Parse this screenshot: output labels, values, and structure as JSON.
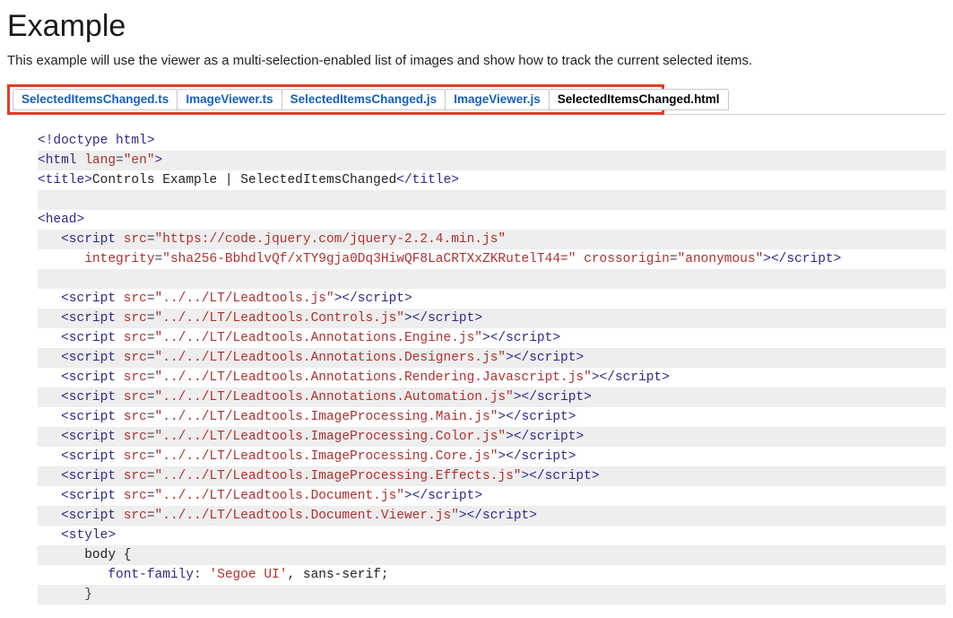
{
  "heading": "Example",
  "description": "This example will use the viewer as a multi-selection-enabled list of images and show how to track the current selected items.",
  "tabs": [
    {
      "label": "SelectedItemsChanged.ts",
      "active": false
    },
    {
      "label": "ImageViewer.ts",
      "active": false
    },
    {
      "label": "SelectedItemsChanged.js",
      "active": false
    },
    {
      "label": "ImageViewer.js",
      "active": false
    },
    {
      "label": "SelectedItemsChanged.html",
      "active": true
    }
  ],
  "code": [
    {
      "indent": 0,
      "stripe": false,
      "tokens": [
        {
          "t": "<!doctype html>",
          "c": "tag"
        }
      ]
    },
    {
      "indent": 0,
      "stripe": true,
      "tokens": [
        {
          "t": "<html ",
          "c": "tag"
        },
        {
          "t": "lang",
          "c": "attr"
        },
        {
          "t": "=",
          "c": "pun"
        },
        {
          "t": "\"en\"",
          "c": "str"
        },
        {
          "t": ">",
          "c": "tag"
        }
      ]
    },
    {
      "indent": 0,
      "stripe": false,
      "tokens": [
        {
          "t": "<title>",
          "c": "tag"
        },
        {
          "t": "Controls Example | SelectedItemsChanged",
          "c": "plain"
        },
        {
          "t": "</title>",
          "c": "tag"
        }
      ]
    },
    {
      "indent": 0,
      "stripe": true,
      "tokens": []
    },
    {
      "indent": 0,
      "stripe": false,
      "tokens": [
        {
          "t": "<head>",
          "c": "tag"
        }
      ]
    },
    {
      "indent": 1,
      "stripe": true,
      "tokens": [
        {
          "t": "<script ",
          "c": "tag"
        },
        {
          "t": "src",
          "c": "attr"
        },
        {
          "t": "=",
          "c": "pun"
        },
        {
          "t": "\"https://code.jquery.com/jquery-2.2.4.min.js\"",
          "c": "str"
        }
      ]
    },
    {
      "indent": 2,
      "stripe": false,
      "tokens": [
        {
          "t": "integrity",
          "c": "attr"
        },
        {
          "t": "=",
          "c": "pun"
        },
        {
          "t": "\"sha256-BbhdlvQf/xTY9gja0Dq3HiwQF8LaCRTXxZKRutelT44=\"",
          "c": "str"
        },
        {
          "t": " ",
          "c": "plain"
        },
        {
          "t": "crossorigin",
          "c": "attr"
        },
        {
          "t": "=",
          "c": "pun"
        },
        {
          "t": "\"anonymous\"",
          "c": "str"
        },
        {
          "t": "></",
          "c": "tag"
        },
        {
          "t": "script",
          "c": "tag"
        },
        {
          "t": ">",
          "c": "tag"
        }
      ]
    },
    {
      "indent": 0,
      "stripe": true,
      "tokens": []
    },
    {
      "indent": 1,
      "stripe": false,
      "tokens": [
        {
          "t": "<script ",
          "c": "tag"
        },
        {
          "t": "src",
          "c": "attr"
        },
        {
          "t": "=",
          "c": "pun"
        },
        {
          "t": "\"../../LT/Leadtools.js\"",
          "c": "str"
        },
        {
          "t": "></",
          "c": "tag"
        },
        {
          "t": "script",
          "c": "tag"
        },
        {
          "t": ">",
          "c": "tag"
        }
      ]
    },
    {
      "indent": 1,
      "stripe": true,
      "tokens": [
        {
          "t": "<script ",
          "c": "tag"
        },
        {
          "t": "src",
          "c": "attr"
        },
        {
          "t": "=",
          "c": "pun"
        },
        {
          "t": "\"../../LT/Leadtools.Controls.js\"",
          "c": "str"
        },
        {
          "t": "></",
          "c": "tag"
        },
        {
          "t": "script",
          "c": "tag"
        },
        {
          "t": ">",
          "c": "tag"
        }
      ]
    },
    {
      "indent": 1,
      "stripe": false,
      "tokens": [
        {
          "t": "<script ",
          "c": "tag"
        },
        {
          "t": "src",
          "c": "attr"
        },
        {
          "t": "=",
          "c": "pun"
        },
        {
          "t": "\"../../LT/Leadtools.Annotations.Engine.js\"",
          "c": "str"
        },
        {
          "t": "></",
          "c": "tag"
        },
        {
          "t": "script",
          "c": "tag"
        },
        {
          "t": ">",
          "c": "tag"
        }
      ]
    },
    {
      "indent": 1,
      "stripe": true,
      "tokens": [
        {
          "t": "<script ",
          "c": "tag"
        },
        {
          "t": "src",
          "c": "attr"
        },
        {
          "t": "=",
          "c": "pun"
        },
        {
          "t": "\"../../LT/Leadtools.Annotations.Designers.js\"",
          "c": "str"
        },
        {
          "t": "></",
          "c": "tag"
        },
        {
          "t": "script",
          "c": "tag"
        },
        {
          "t": ">",
          "c": "tag"
        }
      ]
    },
    {
      "indent": 1,
      "stripe": false,
      "tokens": [
        {
          "t": "<script ",
          "c": "tag"
        },
        {
          "t": "src",
          "c": "attr"
        },
        {
          "t": "=",
          "c": "pun"
        },
        {
          "t": "\"../../LT/Leadtools.Annotations.Rendering.Javascript.js\"",
          "c": "str"
        },
        {
          "t": "></",
          "c": "tag"
        },
        {
          "t": "script",
          "c": "tag"
        },
        {
          "t": ">",
          "c": "tag"
        }
      ]
    },
    {
      "indent": 1,
      "stripe": true,
      "tokens": [
        {
          "t": "<script ",
          "c": "tag"
        },
        {
          "t": "src",
          "c": "attr"
        },
        {
          "t": "=",
          "c": "pun"
        },
        {
          "t": "\"../../LT/Leadtools.Annotations.Automation.js\"",
          "c": "str"
        },
        {
          "t": "></",
          "c": "tag"
        },
        {
          "t": "script",
          "c": "tag"
        },
        {
          "t": ">",
          "c": "tag"
        }
      ]
    },
    {
      "indent": 1,
      "stripe": false,
      "tokens": [
        {
          "t": "<script ",
          "c": "tag"
        },
        {
          "t": "src",
          "c": "attr"
        },
        {
          "t": "=",
          "c": "pun"
        },
        {
          "t": "\"../../LT/Leadtools.ImageProcessing.Main.js\"",
          "c": "str"
        },
        {
          "t": "></",
          "c": "tag"
        },
        {
          "t": "script",
          "c": "tag"
        },
        {
          "t": ">",
          "c": "tag"
        }
      ]
    },
    {
      "indent": 1,
      "stripe": true,
      "tokens": [
        {
          "t": "<script ",
          "c": "tag"
        },
        {
          "t": "src",
          "c": "attr"
        },
        {
          "t": "=",
          "c": "pun"
        },
        {
          "t": "\"../../LT/Leadtools.ImageProcessing.Color.js\"",
          "c": "str"
        },
        {
          "t": "></",
          "c": "tag"
        },
        {
          "t": "script",
          "c": "tag"
        },
        {
          "t": ">",
          "c": "tag"
        }
      ]
    },
    {
      "indent": 1,
      "stripe": false,
      "tokens": [
        {
          "t": "<script ",
          "c": "tag"
        },
        {
          "t": "src",
          "c": "attr"
        },
        {
          "t": "=",
          "c": "pun"
        },
        {
          "t": "\"../../LT/Leadtools.ImageProcessing.Core.js\"",
          "c": "str"
        },
        {
          "t": "></",
          "c": "tag"
        },
        {
          "t": "script",
          "c": "tag"
        },
        {
          "t": ">",
          "c": "tag"
        }
      ]
    },
    {
      "indent": 1,
      "stripe": true,
      "tokens": [
        {
          "t": "<script ",
          "c": "tag"
        },
        {
          "t": "src",
          "c": "attr"
        },
        {
          "t": "=",
          "c": "pun"
        },
        {
          "t": "\"../../LT/Leadtools.ImageProcessing.Effects.js\"",
          "c": "str"
        },
        {
          "t": "></",
          "c": "tag"
        },
        {
          "t": "script",
          "c": "tag"
        },
        {
          "t": ">",
          "c": "tag"
        }
      ]
    },
    {
      "indent": 1,
      "stripe": false,
      "tokens": [
        {
          "t": "<script ",
          "c": "tag"
        },
        {
          "t": "src",
          "c": "attr"
        },
        {
          "t": "=",
          "c": "pun"
        },
        {
          "t": "\"../../LT/Leadtools.Document.js\"",
          "c": "str"
        },
        {
          "t": "></",
          "c": "tag"
        },
        {
          "t": "script",
          "c": "tag"
        },
        {
          "t": ">",
          "c": "tag"
        }
      ]
    },
    {
      "indent": 1,
      "stripe": true,
      "tokens": [
        {
          "t": "<script ",
          "c": "tag"
        },
        {
          "t": "src",
          "c": "attr"
        },
        {
          "t": "=",
          "c": "pun"
        },
        {
          "t": "\"../../LT/Leadtools.Document.Viewer.js\"",
          "c": "str"
        },
        {
          "t": "></",
          "c": "tag"
        },
        {
          "t": "script",
          "c": "tag"
        },
        {
          "t": ">",
          "c": "tag"
        }
      ]
    },
    {
      "indent": 1,
      "stripe": false,
      "tokens": [
        {
          "t": "<style>",
          "c": "tag"
        }
      ]
    },
    {
      "indent": 2,
      "stripe": true,
      "tokens": [
        {
          "t": "body {",
          "c": "plain"
        }
      ]
    },
    {
      "indent": 3,
      "stripe": false,
      "tokens": [
        {
          "t": "font-family",
          "c": "css"
        },
        {
          "t": ": ",
          "c": "pun"
        },
        {
          "t": "'Segoe UI'",
          "c": "sel"
        },
        {
          "t": ", sans-serif;",
          "c": "plain"
        }
      ]
    },
    {
      "indent": 2,
      "stripe": true,
      "tokens": [
        {
          "t": "}",
          "c": "pun"
        }
      ]
    }
  ]
}
